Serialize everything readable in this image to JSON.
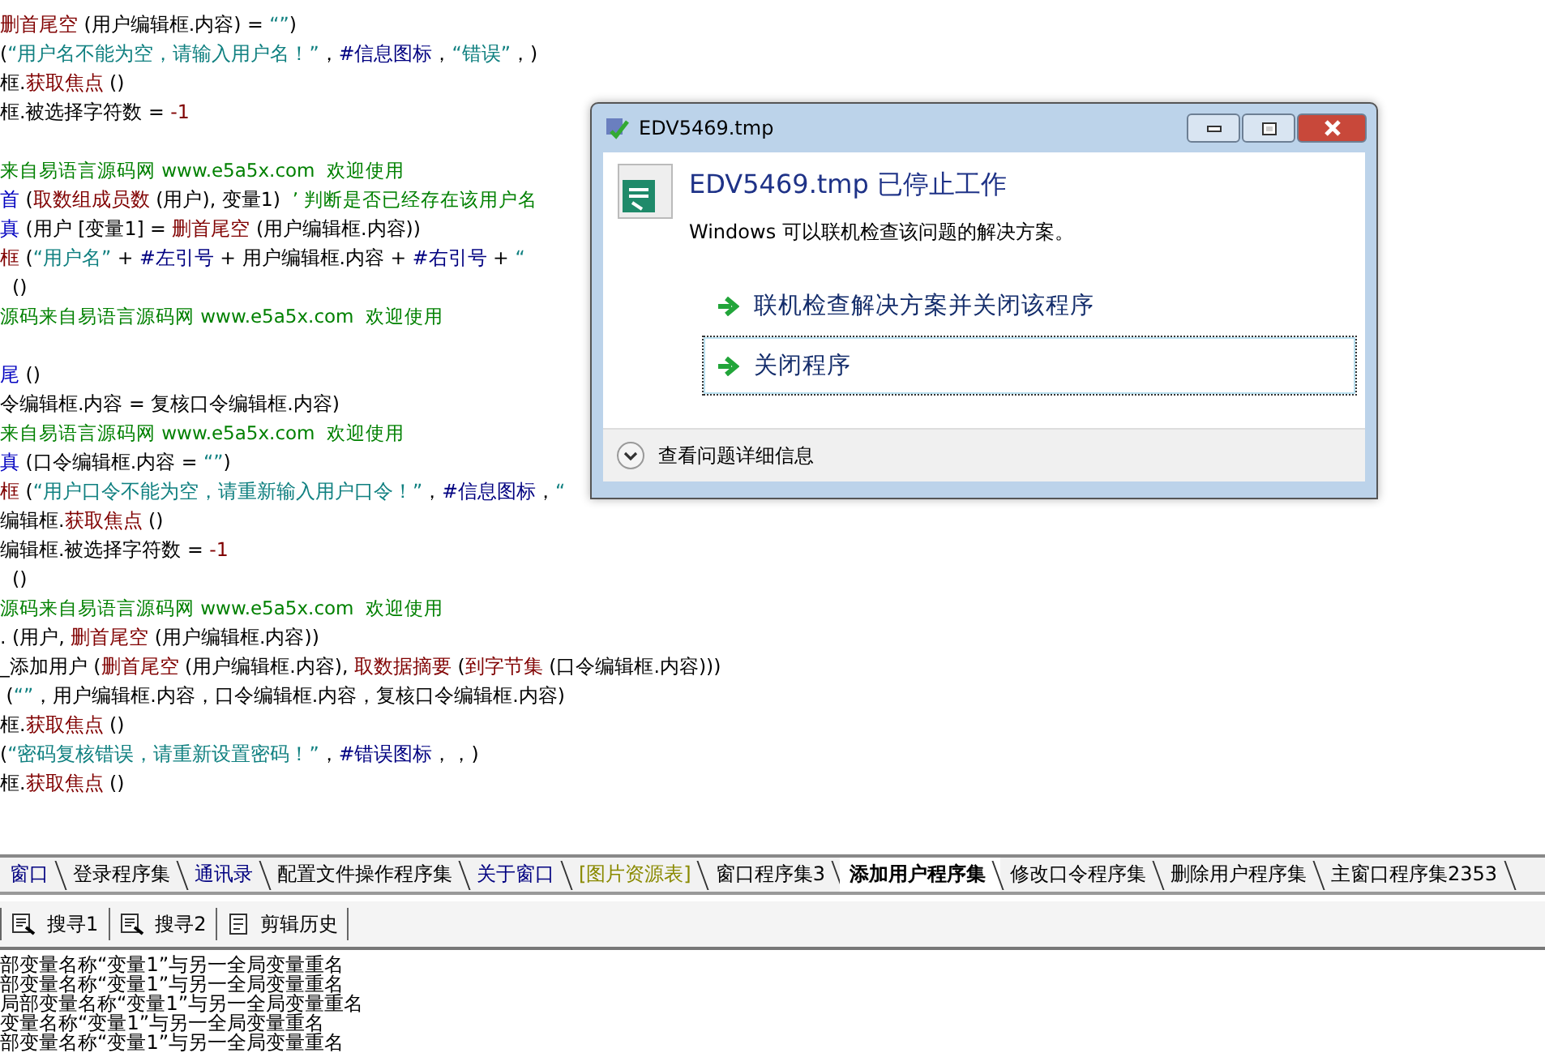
{
  "code_lines": [
    {
      "kind": "code",
      "segments": [
        {
          "kind": "func",
          "text": "删首尾空"
        },
        {
          "kind": "plain",
          "text": " (用户编辑框.内容) = "
        },
        {
          "kind": "str",
          "text": "“”"
        },
        {
          "kind": "plain",
          "text": ")"
        }
      ]
    },
    {
      "kind": "code",
      "segments": [
        {
          "kind": "plain",
          "text": "("
        },
        {
          "kind": "str",
          "text": "“用户名不能为空，请输入用户名！”"
        },
        {
          "kind": "plain",
          "text": "，"
        },
        {
          "kind": "const",
          "text": "#信息图标"
        },
        {
          "kind": "plain",
          "text": "，"
        },
        {
          "kind": "str",
          "text": "“错误”"
        },
        {
          "kind": "plain",
          "text": "，)"
        }
      ]
    },
    {
      "kind": "code",
      "segments": [
        {
          "kind": "plain",
          "text": "框."
        },
        {
          "kind": "func",
          "text": "获取焦点"
        },
        {
          "kind": "plain",
          "text": " ()"
        }
      ]
    },
    {
      "kind": "code",
      "segments": [
        {
          "kind": "plain",
          "text": "框.被选择字符数 = "
        },
        {
          "kind": "num",
          "text": "-1"
        }
      ]
    },
    {
      "kind": "blank"
    },
    {
      "kind": "code",
      "segments": [
        {
          "kind": "comment",
          "text": "来自易语言源码网 www.e5a5x.com  欢迎使用"
        }
      ]
    },
    {
      "kind": "code",
      "segments": [
        {
          "kind": "kw",
          "text": "首"
        },
        {
          "kind": "plain",
          "text": " ("
        },
        {
          "kind": "func",
          "text": "取数组成员数"
        },
        {
          "kind": "plain",
          "text": " (用户), 变量1)  "
        },
        {
          "kind": "comment",
          "text": "’ 判断是否已经存在该用户名"
        }
      ]
    },
    {
      "kind": "code",
      "segments": [
        {
          "kind": "kw",
          "text": "真"
        },
        {
          "kind": "plain",
          "text": " (用户 [变量1] = "
        },
        {
          "kind": "func",
          "text": "删首尾空"
        },
        {
          "kind": "plain",
          "text": " (用户编辑框.内容))"
        }
      ]
    },
    {
      "kind": "code",
      "segments": [
        {
          "kind": "func",
          "text": "框"
        },
        {
          "kind": "plain",
          "text": " ("
        },
        {
          "kind": "str",
          "text": "“用户名”"
        },
        {
          "kind": "plain",
          "text": " + "
        },
        {
          "kind": "const",
          "text": "#左引号"
        },
        {
          "kind": "plain",
          "text": " + 用户编辑框.内容 + "
        },
        {
          "kind": "const",
          "text": "#右引号"
        },
        {
          "kind": "plain",
          "text": " + "
        },
        {
          "kind": "str",
          "text": "“"
        }
      ]
    },
    {
      "kind": "code",
      "segments": [
        {
          "kind": "plain",
          "text": "  ()"
        }
      ]
    },
    {
      "kind": "code",
      "segments": [
        {
          "kind": "comment",
          "text": "源码来自易语言源码网 www.e5a5x.com  欢迎使用"
        }
      ]
    },
    {
      "kind": "blank"
    },
    {
      "kind": "code",
      "segments": [
        {
          "kind": "kw",
          "text": "尾"
        },
        {
          "kind": "plain",
          "text": " ()"
        }
      ]
    },
    {
      "kind": "code",
      "segments": [
        {
          "kind": "plain",
          "text": "令编辑框.内容 = 复核口令编辑框.内容)"
        }
      ]
    },
    {
      "kind": "code",
      "segments": [
        {
          "kind": "comment",
          "text": "来自易语言源码网 www.e5a5x.com  欢迎使用"
        }
      ]
    },
    {
      "kind": "code",
      "segments": [
        {
          "kind": "kw",
          "text": "真"
        },
        {
          "kind": "plain",
          "text": " (口令编辑框.内容 = "
        },
        {
          "kind": "str",
          "text": "“”"
        },
        {
          "kind": "plain",
          "text": ")"
        }
      ]
    },
    {
      "kind": "code",
      "segments": [
        {
          "kind": "func",
          "text": "框"
        },
        {
          "kind": "plain",
          "text": " ("
        },
        {
          "kind": "str",
          "text": "“用户口令不能为空，请重新输入用户口令！”"
        },
        {
          "kind": "plain",
          "text": "，"
        },
        {
          "kind": "const",
          "text": "#信息图标"
        },
        {
          "kind": "plain",
          "text": "，"
        },
        {
          "kind": "str",
          "text": "“"
        }
      ]
    },
    {
      "kind": "code",
      "segments": [
        {
          "kind": "plain",
          "text": "编辑框."
        },
        {
          "kind": "func",
          "text": "获取焦点"
        },
        {
          "kind": "plain",
          "text": " ()"
        }
      ]
    },
    {
      "kind": "code",
      "segments": [
        {
          "kind": "plain",
          "text": "编辑框.被选择字符数 = "
        },
        {
          "kind": "num",
          "text": "-1"
        }
      ]
    },
    {
      "kind": "code",
      "segments": [
        {
          "kind": "plain",
          "text": "  ()"
        }
      ]
    },
    {
      "kind": "code",
      "segments": [
        {
          "kind": "comment",
          "text": "源码来自易语言源码网 www.e5a5x.com  欢迎使用"
        }
      ]
    },
    {
      "kind": "code",
      "segments": [
        {
          "kind": "plain",
          "text": ". (用户, "
        },
        {
          "kind": "func",
          "text": "删首尾空"
        },
        {
          "kind": "plain",
          "text": " (用户编辑框.内容))"
        }
      ]
    },
    {
      "kind": "code",
      "segments": [
        {
          "kind": "plain",
          "text": "_添加用户 ("
        },
        {
          "kind": "func",
          "text": "删首尾空"
        },
        {
          "kind": "plain",
          "text": " (用户编辑框.内容), "
        },
        {
          "kind": "func",
          "text": "取数据摘要"
        },
        {
          "kind": "plain",
          "text": " ("
        },
        {
          "kind": "func",
          "text": "到字节集"
        },
        {
          "kind": "plain",
          "text": " (口令编辑框.内容)))"
        }
      ]
    },
    {
      "kind": "code",
      "segments": [
        {
          "kind": "plain",
          "text": " ("
        },
        {
          "kind": "str",
          "text": "“”"
        },
        {
          "kind": "plain",
          "text": "，用户编辑框.内容，口令编辑框.内容，复核口令编辑框.内容)"
        }
      ]
    },
    {
      "kind": "code",
      "segments": [
        {
          "kind": "plain",
          "text": "框."
        },
        {
          "kind": "func",
          "text": "获取焦点"
        },
        {
          "kind": "plain",
          "text": " ()"
        }
      ]
    },
    {
      "kind": "code",
      "segments": [
        {
          "kind": "plain",
          "text": "("
        },
        {
          "kind": "str",
          "text": "“密码复核错误，请重新设置密码！”"
        },
        {
          "kind": "plain",
          "text": "，"
        },
        {
          "kind": "const",
          "text": "#错误图标"
        },
        {
          "kind": "plain",
          "text": "，，)"
        }
      ]
    },
    {
      "kind": "code",
      "segments": [
        {
          "kind": "plain",
          "text": "框."
        },
        {
          "kind": "func",
          "text": "获取焦点"
        },
        {
          "kind": "plain",
          "text": " ()"
        }
      ]
    }
  ],
  "file_tabs": [
    {
      "label": "窗口",
      "kind": "window",
      "selected": false
    },
    {
      "label": "登录程序集",
      "kind": "module",
      "selected": false
    },
    {
      "label": "通讯录",
      "kind": "window",
      "selected": false
    },
    {
      "label": "配置文件操作程序集",
      "kind": "module",
      "selected": false
    },
    {
      "label": "关于窗口",
      "kind": "window",
      "selected": false
    },
    {
      "label": "[图片资源表]",
      "kind": "resource",
      "selected": false
    },
    {
      "label": "窗口程序集3",
      "kind": "module",
      "selected": false
    },
    {
      "label": "添加用户程序集",
      "kind": "module",
      "selected": true
    },
    {
      "label": "修改口令程序集",
      "kind": "module",
      "selected": false
    },
    {
      "label": "删除用户程序集",
      "kind": "module",
      "selected": false
    },
    {
      "label": "主窗口程序集2353",
      "kind": "module",
      "selected": false
    }
  ],
  "output_tabs": [
    {
      "label": "搜寻1",
      "kind": "search"
    },
    {
      "label": "搜寻2",
      "kind": "search"
    },
    {
      "label": "剪辑历史",
      "kind": "history"
    }
  ],
  "output_lines": [
    "部变量名称“变量1”与另一全局变量重名",
    "部变量名称“变量1”与另一全局变量重名",
    "局部变量名称“变量1”与另一全局变量重名",
    "变量名称“变量1”与另一全局变量重名",
    "部变量名称“变量1”与另一全局变量重名"
  ],
  "dialog": {
    "title": "EDV5469.tmp",
    "heading": "EDV5469.tmp 已停止工作",
    "message": "Windows 可以联机检查该问题的解决方案。",
    "commands": [
      {
        "label": "联机检查解决方案并关闭该程序",
        "focused": false
      },
      {
        "label": "关闭程序",
        "focused": true
      }
    ],
    "details": "查看问题详细信息"
  }
}
